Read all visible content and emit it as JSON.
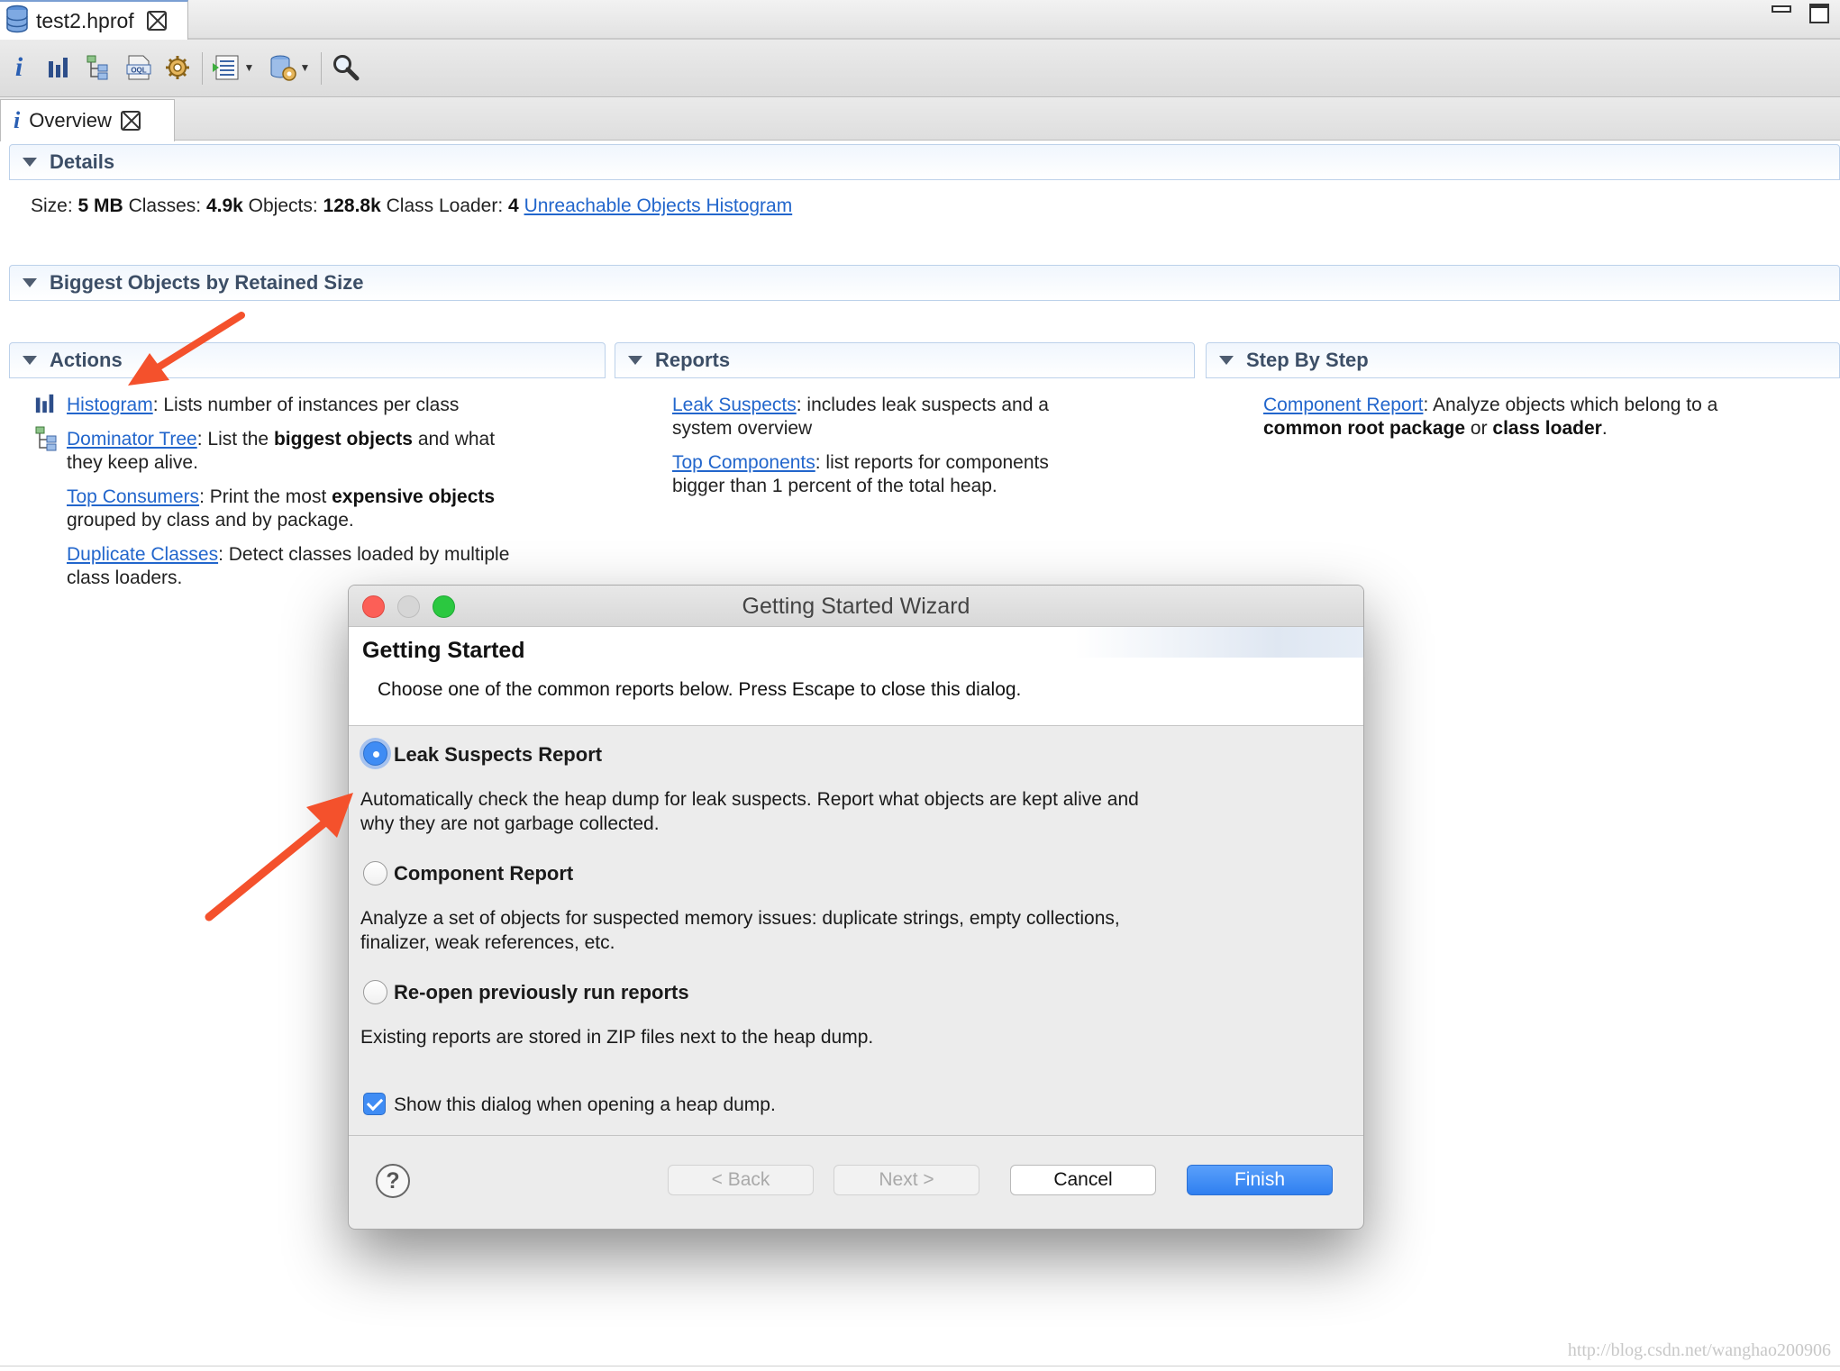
{
  "editor_tab": {
    "label": "test2.hprof",
    "icon": "heap-dump-database-icon"
  },
  "toolbar": {
    "buttons": [
      "overview-info-icon",
      "histogram-icon",
      "dominator-tree-icon",
      "oql-icon",
      "thread-overview-icon",
      "query-browser-icon",
      "heap-dump-actions-icon",
      "search-icon"
    ],
    "oql_text": "OQL"
  },
  "inner_tab": {
    "label": "Overview"
  },
  "details": {
    "header": "Details",
    "size_label": "Size:",
    "size_value": "5 MB",
    "classes_label": "Classes:",
    "classes_value": "4.9k",
    "objects_label": "Objects:",
    "objects_value": "128.8k",
    "class_loader_label": "Class Loader:",
    "class_loader_value": "4",
    "unreachable_link": "Unreachable Objects Histogram"
  },
  "biggest_objects": {
    "header": "Biggest Objects by Retained Size"
  },
  "actions": {
    "header": "Actions",
    "histogram": {
      "link": "Histogram",
      "desc": ": Lists number of instances per class"
    },
    "dominator": {
      "link": "Dominator Tree",
      "desc_pre": ": List the ",
      "desc_bold": "biggest objects",
      "desc_post": " and what",
      "desc_line2": "they keep alive."
    },
    "consumers": {
      "link": "Top Consumers",
      "desc_pre": ": Print the most ",
      "desc_bold": "expensive objects",
      "desc_line2": "grouped by class and by package."
    },
    "duplicate": {
      "link": "Duplicate Classes",
      "desc": ": Detect classes loaded by multiple",
      "desc_line2": "class loaders."
    }
  },
  "reports": {
    "header": "Reports",
    "leak": {
      "link": "Leak Suspects",
      "desc": ": includes leak suspects and a",
      "desc_line2": "system overview"
    },
    "top_components": {
      "link": "Top Components",
      "desc": ": list reports for components",
      "desc_line2": "bigger than 1 percent of the total heap."
    }
  },
  "step_by_step": {
    "header": "Step By Step",
    "component": {
      "link": "Component Report",
      "desc": ": Analyze objects which belong to a",
      "bold1": "common root package",
      "mid": " or ",
      "bold2": "class loader",
      "end": "."
    }
  },
  "dialog": {
    "title": "Getting Started Wizard",
    "heading": "Getting Started",
    "subtitle": "Choose one of the common reports below. Press Escape to close this dialog.",
    "options": [
      {
        "label": "Leak Suspects Report",
        "selected": true,
        "desc": "Automatically check the heap dump for leak suspects. Report what objects are kept alive and why they are not garbage collected."
      },
      {
        "label": "Component Report",
        "selected": false,
        "desc": "Analyze a set of objects for suspected memory issues: duplicate strings, empty collections, finalizer, weak references, etc."
      },
      {
        "label": "Re-open previously run reports",
        "selected": false,
        "desc": "Existing reports are stored in ZIP files next to the heap dump."
      }
    ],
    "checkbox_label": "Show this dialog when opening a heap dump.",
    "checkbox_checked": true,
    "help": "?",
    "buttons": {
      "back": "< Back",
      "next": "Next >",
      "cancel": "Cancel",
      "finish": "Finish"
    }
  },
  "watermark": "http://blog.csdn.net/wanghao200906",
  "colors": {
    "accent": "#2f7ff0",
    "link": "#2266cc",
    "annotation_arrow": "#f4512c"
  }
}
